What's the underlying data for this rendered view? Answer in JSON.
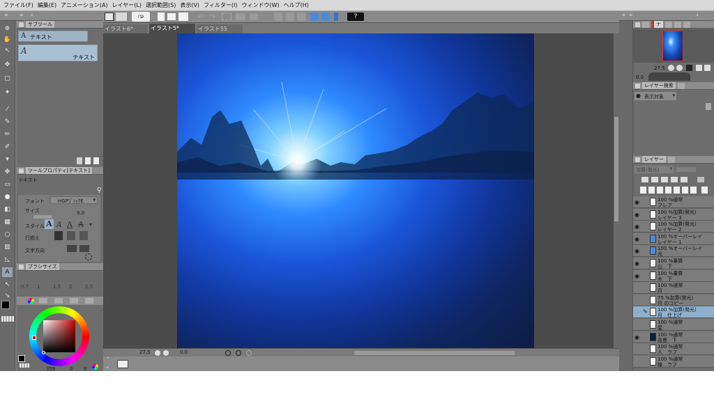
{
  "menu": [
    "ファイル(F)",
    "編集(E)",
    "アニメーション(A)",
    "レイヤー(L)",
    "選択範囲(S)",
    "表示(V)",
    "フィルター(I)",
    "ウィンドウ(W)",
    "ヘルプ(H)"
  ],
  "doc_tabs": [
    "イラスト6*",
    "イラスト5*",
    "イラスト55"
  ],
  "subtool": {
    "tab": "サブツール",
    "items": [
      {
        "icon": "A",
        "label": "テキスト"
      },
      {
        "icon": "A",
        "label": "テキスト"
      }
    ]
  },
  "tool_property": {
    "tab": "ツールプロパティ[テキスト]",
    "name": "テキスト",
    "font_label": "フォント",
    "font_value": "HGPｺﾞｼｯｸE",
    "size_label": "サイズ",
    "size_value": "9.0",
    "style_label": "スタイル",
    "align_label": "行揃え",
    "direction_label": "文字方向"
  },
  "brush_size": {
    "tab": "ブラシサイズ",
    "values": [
      "0.7",
      "1",
      "1.5",
      "2",
      "2.5"
    ]
  },
  "color": {
    "hue_value": "359",
    "v1": "0",
    "v2": "0",
    "main_color": "#000000",
    "sub_color": "#ffffff",
    "picker_color": "#b01818"
  },
  "status": {
    "zoom": "27.5",
    "angle": "0.0"
  },
  "navigator": {
    "tab": "ナ",
    "zoom": "27.5",
    "angle": "0.0"
  },
  "layer_search": {
    "tab": "レイヤー検索",
    "target": "表示対象"
  },
  "layers_panel": {
    "tab": "レイヤー",
    "blend": "加算(発光)"
  },
  "layers": [
    {
      "mode": "100 %通常",
      "name": "フレア",
      "visible": true,
      "selected": false,
      "thumb": "plain"
    },
    {
      "mode": "100 %加算(発光)",
      "name": "レイヤー 3",
      "visible": true,
      "selected": false,
      "thumb": "plain"
    },
    {
      "mode": "100 %加算(発光)",
      "name": "レイヤー 2",
      "visible": true,
      "selected": false,
      "thumb": "plain"
    },
    {
      "mode": "100 %オーバーレイ",
      "name": "レイヤー 1",
      "visible": true,
      "selected": false,
      "thumb": "blue"
    },
    {
      "mode": "100 %オーバーレイ",
      "name": "光",
      "visible": true,
      "selected": false,
      "thumb": "blue"
    },
    {
      "mode": "100 %乗算",
      "name": "山　下",
      "visible": true,
      "selected": false,
      "thumb": "plain"
    },
    {
      "mode": "100 %乗算",
      "name": "木　下",
      "visible": true,
      "selected": false,
      "thumb": "plain"
    },
    {
      "mode": "100 %通常",
      "name": "月",
      "visible": false,
      "selected": false,
      "thumb": "plain"
    },
    {
      "mode": "75 %加算(発光)",
      "name": "月 のコピー",
      "visible": false,
      "selected": false,
      "thumb": "plain"
    },
    {
      "mode": "100 %加算(発光)",
      "name": "月　仕上げ",
      "visible": false,
      "selected": true,
      "thumb": "plain"
    },
    {
      "mode": "100 %通常",
      "name": "星",
      "visible": false,
      "selected": false,
      "thumb": "plain"
    },
    {
      "mode": "100 %通常",
      "name": "背景　下",
      "visible": true,
      "selected": false,
      "thumb": "dark"
    },
    {
      "mode": "100 %通常",
      "name": "人　ラフ",
      "visible": false,
      "selected": false,
      "thumb": "plain"
    },
    {
      "mode": "100 %通常",
      "name": "線　ラフ",
      "visible": false,
      "selected": false,
      "thumb": "plain"
    }
  ]
}
